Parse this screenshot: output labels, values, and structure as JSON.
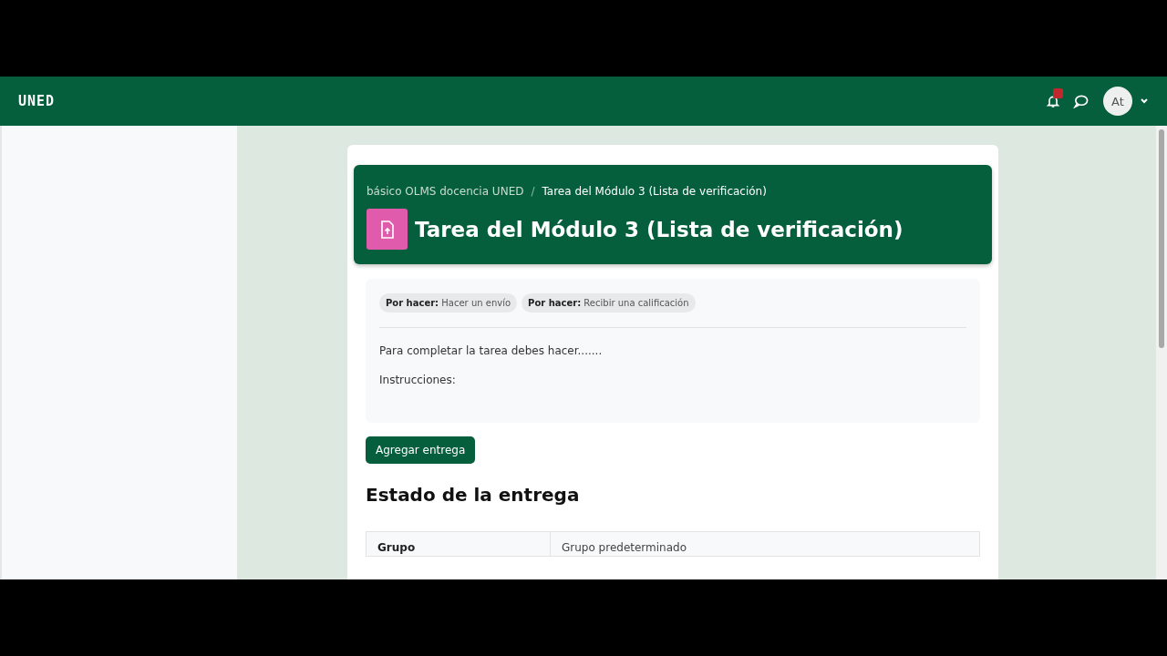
{
  "header": {
    "logo": "UNED",
    "notifications": {
      "unread": true
    },
    "avatar": "At"
  },
  "breadcrumb_separator": "/",
  "breadcrumb": [
    "básico OLMS docencia UNED",
    "Tarea del Módulo 3 (Lista de verificación)"
  ],
  "title": "Tarea del Módulo 3 (Lista de verificación)",
  "badges": [
    "**Por hacer:** Hacer un envío",
    "**Por hacer:** Recibir una calificación"
  ],
  "intro": [
    "Para completar la tarea debes hacer.......",
    "Instrucciones:"
  ],
  "button": "Agregar entrega",
  "section_title": "Estado de la entrega",
  "table": {
    "rows": [
      {
        "label": "Grupo",
        "value": "Grupo predeterminado"
      }
    ]
  }
}
